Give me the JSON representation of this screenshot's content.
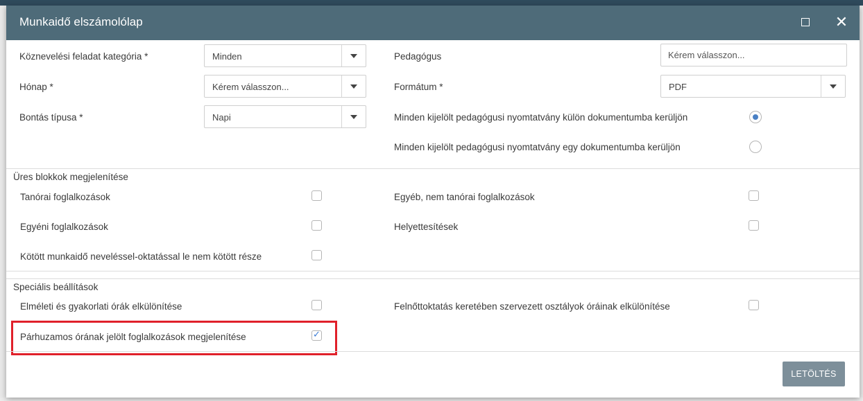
{
  "window": {
    "title": "Munkaidő elszámolólap",
    "maximize_label": "",
    "close_label": "✕"
  },
  "form": {
    "kategoria": {
      "label": "Köznevelési feladat kategória *",
      "value": "Minden"
    },
    "honap": {
      "label": "Hónap *",
      "value": "Kérem válasszon..."
    },
    "bontas": {
      "label": "Bontás típusa *",
      "value": "Napi"
    },
    "pedagogus": {
      "label": "Pedagógus",
      "placeholder": "Kérem válasszon..."
    },
    "formatum": {
      "label": "Formátum *",
      "value": "PDF"
    },
    "radio_kulon": {
      "label": "Minden kijelölt pedagógusi nyomtatvány külön dokumentumba kerüljön",
      "checked": true
    },
    "radio_egy": {
      "label": "Minden kijelölt pedagógusi nyomtatvány egy dokumentumba kerüljön",
      "checked": false
    }
  },
  "ures_blokkok": {
    "title": "Üres blokkok megjelenítése",
    "items": [
      {
        "label": "Tanórai foglalkozások",
        "checked": false
      },
      {
        "label": "Egyéb, nem tanórai foglalkozások",
        "checked": false
      },
      {
        "label": "Egyéni foglalkozások",
        "checked": false
      },
      {
        "label": "Helyettesítések",
        "checked": false
      },
      {
        "label": "Kötött munkaidő neveléssel-oktatással le nem kötött része",
        "checked": false
      }
    ]
  },
  "specialis": {
    "title": "Speciális beállítások",
    "items": [
      {
        "label": "Elméleti és gyakorlati órák elkülönítése",
        "checked": false
      },
      {
        "label": "Felnőttoktatás keretében szervezett osztályok óráinak elkülönítése",
        "checked": false
      },
      {
        "label": "Párhuzamos órának jelölt foglalkozások megjelenítése",
        "checked": true
      }
    ]
  },
  "actions": {
    "download_label": "LETÖLTÉS"
  },
  "colors": {
    "titlebar": "#4e6b79",
    "highlight": "#e0202a",
    "button": "#7d8f9a",
    "radio_on": "#4a80c4"
  }
}
